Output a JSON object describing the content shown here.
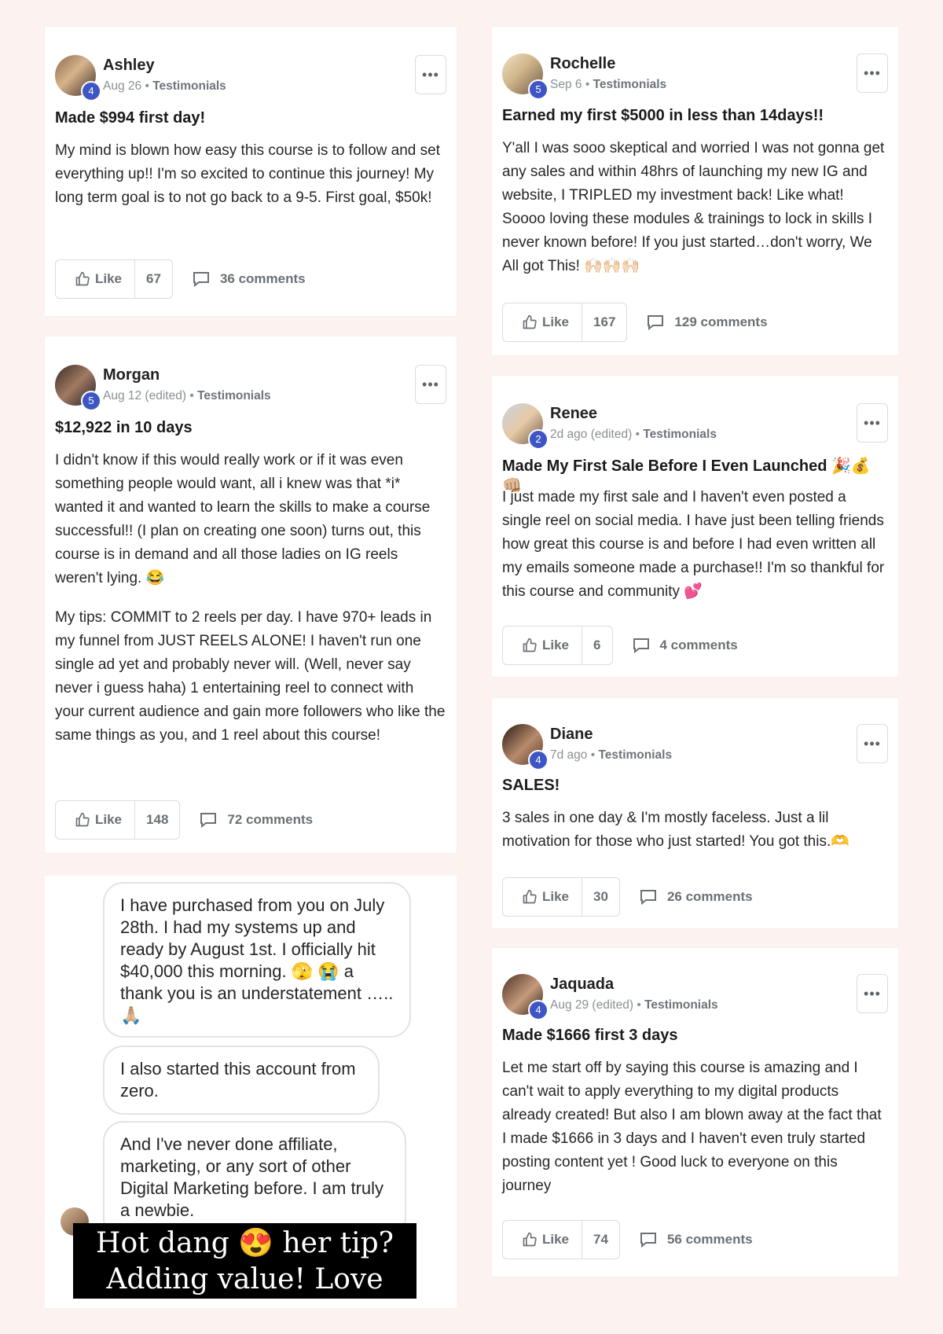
{
  "common": {
    "like_label": "Like",
    "more_label": "•••"
  },
  "posts": [
    {
      "author": "Ashley",
      "level": "4",
      "date": "Aug 26",
      "separator": "•",
      "category": "Testimonials",
      "title": "Made $994 first day!",
      "body": [
        "My mind is blown how easy this course is to follow and set everything up!! I'm so excited to continue this journey! My long term goal is to not go back to a 9-5. First goal, $50k!"
      ],
      "likes": "67",
      "comments": "36 comments"
    },
    {
      "author": "Morgan",
      "level": "5",
      "date": "Aug 12 (edited)",
      "separator": "•",
      "category": "Testimonials",
      "title": "$12,922 in 10 days",
      "body": [
        "I didn't know if this would really work or if it was even something people would want, all i knew was that *i* wanted it and wanted to learn the skills to make a course successful!! (I plan on creating one soon) turns out, this course is in demand and all those ladies on IG reels weren't lying. 😂",
        "My tips: COMMIT to 2 reels per day. I have 970+ leads in my funnel from JUST REELS ALONE! I haven't run one single ad yet and probably never will. (Well, never say never i guess haha) 1 entertaining reel to connect with your current audience and gain more followers who like the same things as you, and 1 reel about this course!"
      ],
      "likes": "148",
      "comments": "72 comments"
    },
    {
      "author": "Rochelle",
      "level": "5",
      "date": "Sep 6",
      "separator": "•",
      "category": "Testimonials",
      "title": "Earned my first $5000 in less than 14days!!",
      "body": [
        "Y'all I was sooo skeptical and worried I was not gonna get any sales and within 48hrs of launching my new IG and website, I TRIPLED my investment back! Like what! Soooo loving these modules & trainings to lock in skills I never known before! If you just started…don't worry, We All got This! 🙌🏻🙌🏻🙌🏻"
      ],
      "likes": "167",
      "comments": "129 comments"
    },
    {
      "author": "Renee",
      "level": "2",
      "date": "2d ago (edited)",
      "separator": "•",
      "category": "Testimonials",
      "title": "Made My First Sale Before I Even Launched 🎉💰👊🏼",
      "body": [
        "I just made my first sale and I haven't even posted a single reel on social media. I have just been telling friends how great this course is and before I had even written all my emails someone made a purchase!! I'm so thankful for this course and community 💕"
      ],
      "likes": "6",
      "comments": "4 comments"
    },
    {
      "author": "Diane",
      "level": "4",
      "date": "7d ago",
      "separator": "•",
      "category": "Testimonials",
      "title": "SALES!",
      "body": [
        "3 sales in one day & I'm mostly faceless. Just a lil motivation for those who just started! You got this.🫶"
      ],
      "likes": "30",
      "comments": "26 comments"
    },
    {
      "author": "Jaquada",
      "level": "4",
      "date": "Aug 29 (edited)",
      "separator": "•",
      "category": "Testimonials",
      "title": "Made $1666 first 3 days",
      "body": [
        "Let me start off by saying this course is amazing and I can't wait to apply everything to my digital products already created! But also I am blown away at the fact that I made $1666 in 3 days and I haven't even truly started posting content yet ! Good luck to everyone on this journey"
      ],
      "likes": "74",
      "comments": "56 comments"
    }
  ],
  "chat": {
    "messages": [
      "I have purchased from you on July 28th.  I had my systems up and ready by August 1st.   I officially hit $40,000 this morning. 🫣 😭  a thank you is an understatement ….. 🙏🏼",
      "I also started this account from zero.",
      "And I've never done affiliate, marketing, or any sort of other Digital Marketing before. I am truly a newbie."
    ],
    "caption_line1": "Hot dang 😍 her tip?",
    "caption_line2": "Adding value! Love this!"
  }
}
